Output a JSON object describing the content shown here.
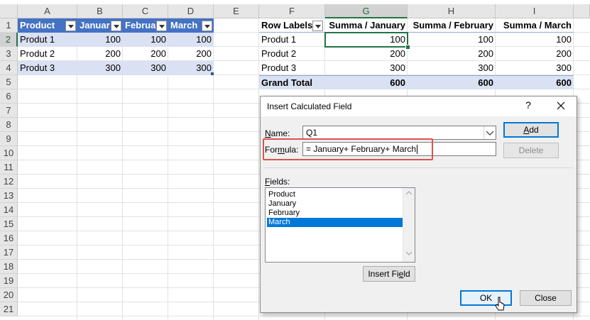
{
  "columns": [
    "A",
    "B",
    "C",
    "D",
    "E",
    "F",
    "G",
    "H",
    "I"
  ],
  "rows": [
    "1",
    "2",
    "3",
    "4",
    "5",
    "6",
    "7",
    "8",
    "9",
    "10",
    "11",
    "12",
    "13",
    "14",
    "15",
    "16",
    "17",
    "18",
    "19",
    "20",
    "21"
  ],
  "table": {
    "headers": [
      "Product",
      "January",
      "February",
      "March"
    ],
    "header_display": [
      "Product",
      "Januar",
      "Februa",
      "March"
    ],
    "rows": [
      [
        "Produt 1",
        "100",
        "100",
        "100"
      ],
      [
        "Produt 2",
        "200",
        "200",
        "200"
      ],
      [
        "Produt 3",
        "300",
        "300",
        "300"
      ]
    ]
  },
  "pivot": {
    "headers": [
      "Row Labels",
      "Summa  / January",
      "Summa  / February",
      "Summa  / March"
    ],
    "rows": [
      [
        "Produt 1",
        "100",
        "100",
        "100"
      ],
      [
        "Produt 2",
        "200",
        "200",
        "200"
      ],
      [
        "Produt 3",
        "300",
        "300",
        "300"
      ]
    ],
    "total": [
      "Grand Total",
      "600",
      "600",
      "600"
    ]
  },
  "dialog": {
    "title": "Insert Calculated Field",
    "help": "?",
    "name_label_u": "N",
    "name_label_rest": "ame:",
    "name_value": "Q1",
    "formula_label_pre": "For",
    "formula_label_u": "m",
    "formula_label_post": "ula:",
    "formula_value": "= January+ February+ March",
    "add_u": "A",
    "add_rest": "dd",
    "delete_label": "Delete",
    "fields_label_u": "F",
    "fields_label_rest": "ields:",
    "fields": [
      "Product",
      "January",
      "February",
      "March"
    ],
    "selected_field": "March",
    "insert_field_pre": "Insert Fi",
    "insert_field_u": "e",
    "insert_field_post": "ld",
    "ok_label": "OK",
    "close_label": "Close"
  },
  "colors": {
    "table_header": "#4472c4",
    "table_band": "#d9e1f2",
    "selection": "#217346",
    "highlight_box": "#d9534f",
    "list_selected": "#0078d7"
  }
}
